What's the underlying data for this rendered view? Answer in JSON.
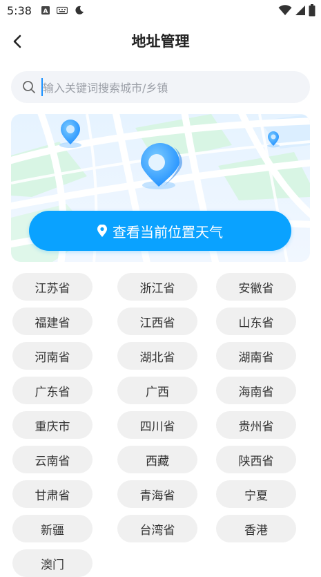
{
  "status_bar": {
    "time": "5:38",
    "left_icons": [
      "font-icon",
      "keyboard-icon",
      "moon-icon"
    ],
    "right_icons": [
      "wifi-icon",
      "signal-icon",
      "battery-icon"
    ]
  },
  "nav": {
    "title": "地址管理",
    "back_icon": "chevron-left-icon"
  },
  "search": {
    "placeholder": "输入关键词搜索城市/乡镇",
    "value": ""
  },
  "map": {
    "button_label": "查看当前位置天气",
    "button_color": "#0aa2ff"
  },
  "provinces": [
    "江苏省",
    "浙江省",
    "安徽省",
    "福建省",
    "江西省",
    "山东省",
    "河南省",
    "湖北省",
    "湖南省",
    "广东省",
    "广西",
    "海南省",
    "重庆市",
    "四川省",
    "贵州省",
    "云南省",
    "西藏",
    "陕西省",
    "甘肃省",
    "青海省",
    "宁夏",
    "新疆",
    "台湾省",
    "香港",
    "澳门"
  ],
  "colors": {
    "chip_bg": "#f0f0f0",
    "accent": "#0aa2ff",
    "search_bg": "#f2f4f8"
  }
}
